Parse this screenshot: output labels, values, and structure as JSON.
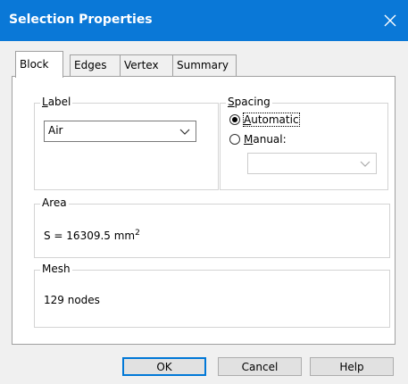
{
  "window": {
    "title": "Selection Properties"
  },
  "tabs": [
    {
      "label": "Block",
      "active": true
    },
    {
      "label": "Edges",
      "active": false
    },
    {
      "label": "Vertex",
      "active": false
    },
    {
      "label": "Summary",
      "active": false
    }
  ],
  "label_group": {
    "title_prefix": "",
    "title_mnemonic": "L",
    "title_rest": "abel",
    "value": "Air"
  },
  "spacing_group": {
    "title_mnemonic": "S",
    "title_rest": "pacing",
    "automatic": {
      "mnemonic": "A",
      "rest": "utomatic",
      "selected": true
    },
    "manual": {
      "mnemonic": "M",
      "rest": "anual:",
      "selected": false
    },
    "manual_value": ""
  },
  "area_group": {
    "title": "Area",
    "formula": "S = 16309.5 mm",
    "superscript": "2"
  },
  "mesh_group": {
    "title": "Mesh",
    "text": "129 nodes"
  },
  "buttons": {
    "ok": "OK",
    "cancel": "Cancel",
    "help": "Help"
  },
  "colors": {
    "titlebar": "#0a78d7",
    "default_button_border": "#0078d7"
  }
}
